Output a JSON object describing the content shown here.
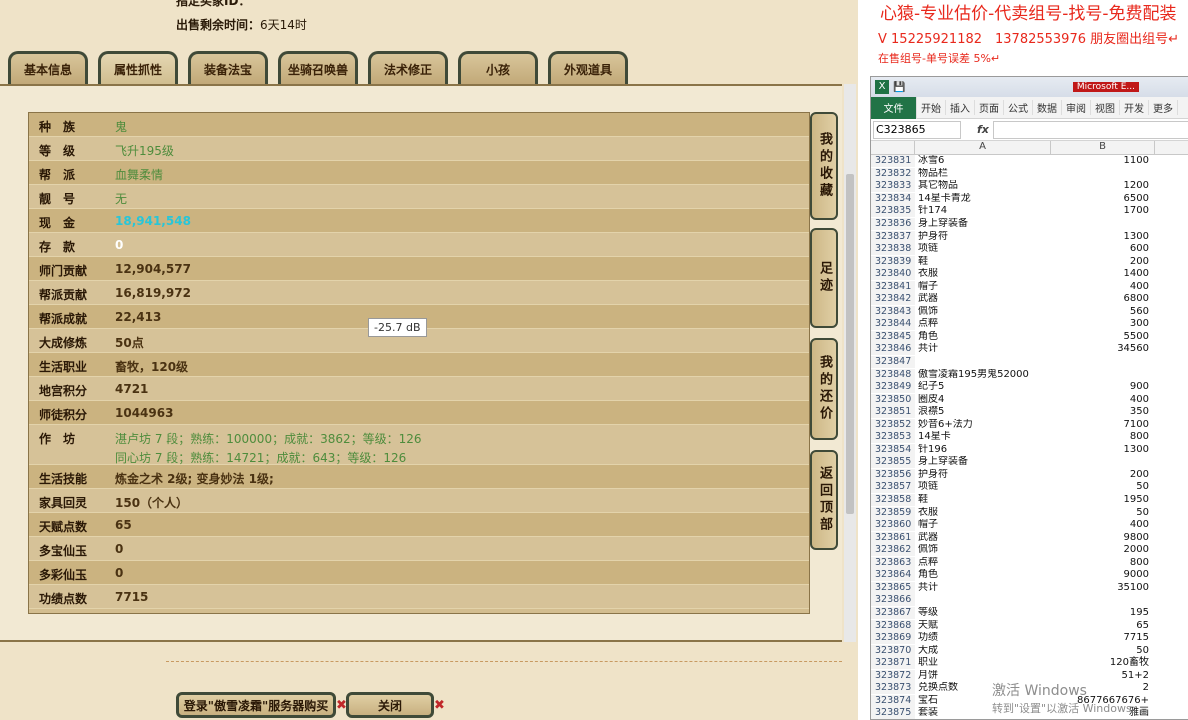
{
  "header": {
    "partial": "指定买家ID：",
    "remaining_label": "出售剩余时间：",
    "remaining_value": "6天14时"
  },
  "tabs": [
    "基本信息",
    "属性抓性",
    "装备法宝",
    "坐骑召唤兽",
    "法术修正",
    "小孩",
    "外观道具"
  ],
  "rows": [
    {
      "k": "种　族",
      "v": "鬼",
      "s": "g"
    },
    {
      "k": "等　级",
      "v": "飞升195级",
      "s": "g"
    },
    {
      "k": "帮　派",
      "v": "血舞柔情",
      "s": "g"
    },
    {
      "k": "靓　号",
      "v": "无",
      "s": "g"
    },
    {
      "k": "现　金",
      "v": "18,941,548",
      "s": "c"
    },
    {
      "k": "存　款",
      "v": "0",
      "s": "w"
    },
    {
      "k": "师门贡献",
      "v": "12,904,577",
      "s": ""
    },
    {
      "k": "帮派贡献",
      "v": "16,819,972",
      "s": ""
    },
    {
      "k": "帮派成就",
      "v": "22,413",
      "s": ""
    },
    {
      "k": "大成修炼",
      "v": "50点",
      "s": ""
    },
    {
      "k": "生活职业",
      "v": "畜牧，120级",
      "s": ""
    },
    {
      "k": "地宫积分",
      "v": "4721",
      "s": ""
    },
    {
      "k": "师徒积分",
      "v": "1044963",
      "s": ""
    },
    {
      "k": "作　坊",
      "v": "湛卢坊 7 段；熟练：100000；成就：3862；等级：126",
      "v2": "同心坊 7 段；熟练：14721；成就：643；等级：126",
      "s": "g"
    },
    {
      "k": "生活技能",
      "v": "炼金之术 2级; 变身妙法 1级;",
      "s": ""
    },
    {
      "k": "家具回灵",
      "v": "150（个人）",
      "s": ""
    },
    {
      "k": "天赋点数",
      "v": "65",
      "s": ""
    },
    {
      "k": "多宝仙玉",
      "v": "0",
      "s": ""
    },
    {
      "k": "多彩仙玉",
      "v": "0",
      "s": ""
    },
    {
      "k": "功绩点数",
      "v": "7715",
      "s": ""
    }
  ],
  "side_buttons": [
    "我的收藏",
    "足迹",
    "我的还价",
    "返回顶部"
  ],
  "tooltip": "-25.7 dB",
  "buttons": {
    "buy": "登录\"傲雪凌霜\"服务器购买",
    "close": "关闭"
  },
  "right": {
    "line1": "心猿-专业估价-代卖组号-找号-免费配装",
    "line2": "V 15225921182　13782553976 朋友圈出组号↵",
    "line3": "在售组号-单号误差 5%↵",
    "excel_title": "Microsoft E...",
    "ribbon": [
      "文件",
      "开始",
      "插入",
      "页面",
      "公式",
      "数据",
      "审阅",
      "视图",
      "开发",
      "更多"
    ],
    "namebox": "C323865",
    "fx": "fx",
    "colA": "A",
    "colB": "B",
    "watermark1": "激活 Windows",
    "watermark2": "转到\"设置\"以激活 Windows。",
    "cells": [
      [
        "323831",
        "冰雪6",
        "1100"
      ],
      [
        "323832",
        "物品栏",
        ""
      ],
      [
        "323833",
        "其它物品",
        "1200"
      ],
      [
        "323834",
        "14星卡青龙",
        "6500"
      ],
      [
        "323835",
        "针174",
        "1700"
      ],
      [
        "323836",
        "身上穿装备",
        ""
      ],
      [
        "323837",
        "护身符",
        "1300"
      ],
      [
        "323838",
        "项链",
        "600"
      ],
      [
        "323839",
        "鞋",
        "200"
      ],
      [
        "323840",
        "衣服",
        "1400"
      ],
      [
        "323841",
        "帽子",
        "400"
      ],
      [
        "323842",
        "武器",
        "6800"
      ],
      [
        "323843",
        "佩饰",
        "560"
      ],
      [
        "323844",
        "点粹",
        "300"
      ],
      [
        "323845",
        "角色",
        "5500"
      ],
      [
        "323846",
        "共计",
        "34560"
      ],
      [
        "323847",
        "",
        ""
      ],
      [
        "323848",
        "傲雪凌霜195男鬼52000",
        ""
      ],
      [
        "323849",
        "纪子5",
        "900"
      ],
      [
        "323850",
        "圈皮4",
        "400"
      ],
      [
        "323851",
        "浪襟5",
        "350"
      ],
      [
        "323852",
        "妙音6+法力",
        "7100"
      ],
      [
        "323853",
        "14星卡",
        "800"
      ],
      [
        "323854",
        "针196",
        "1300"
      ],
      [
        "323855",
        "身上穿装备",
        ""
      ],
      [
        "323856",
        "护身符",
        "200"
      ],
      [
        "323857",
        "项链",
        "50"
      ],
      [
        "323858",
        "鞋",
        "1950"
      ],
      [
        "323859",
        "衣服",
        "50"
      ],
      [
        "323860",
        "帽子",
        "400"
      ],
      [
        "323861",
        "武器",
        "9800"
      ],
      [
        "323862",
        "佩饰",
        "2000"
      ],
      [
        "323863",
        "点粹",
        "800"
      ],
      [
        "323864",
        "角色",
        "9000"
      ],
      [
        "323865",
        "共计",
        "35100"
      ],
      [
        "323866",
        "",
        ""
      ],
      [
        "323867",
        "等级",
        "195"
      ],
      [
        "323868",
        "天赋",
        "65"
      ],
      [
        "323869",
        "功绩",
        "7715"
      ],
      [
        "323870",
        "大成",
        "50"
      ],
      [
        "323871",
        "职业",
        "120畜牧"
      ],
      [
        "323872",
        "月饼",
        "51+2"
      ],
      [
        "323873",
        "兑换点数",
        "2"
      ],
      [
        "323874",
        "宝石",
        "8677667676+"
      ],
      [
        "323875",
        "套装",
        "雅画"
      ]
    ]
  }
}
